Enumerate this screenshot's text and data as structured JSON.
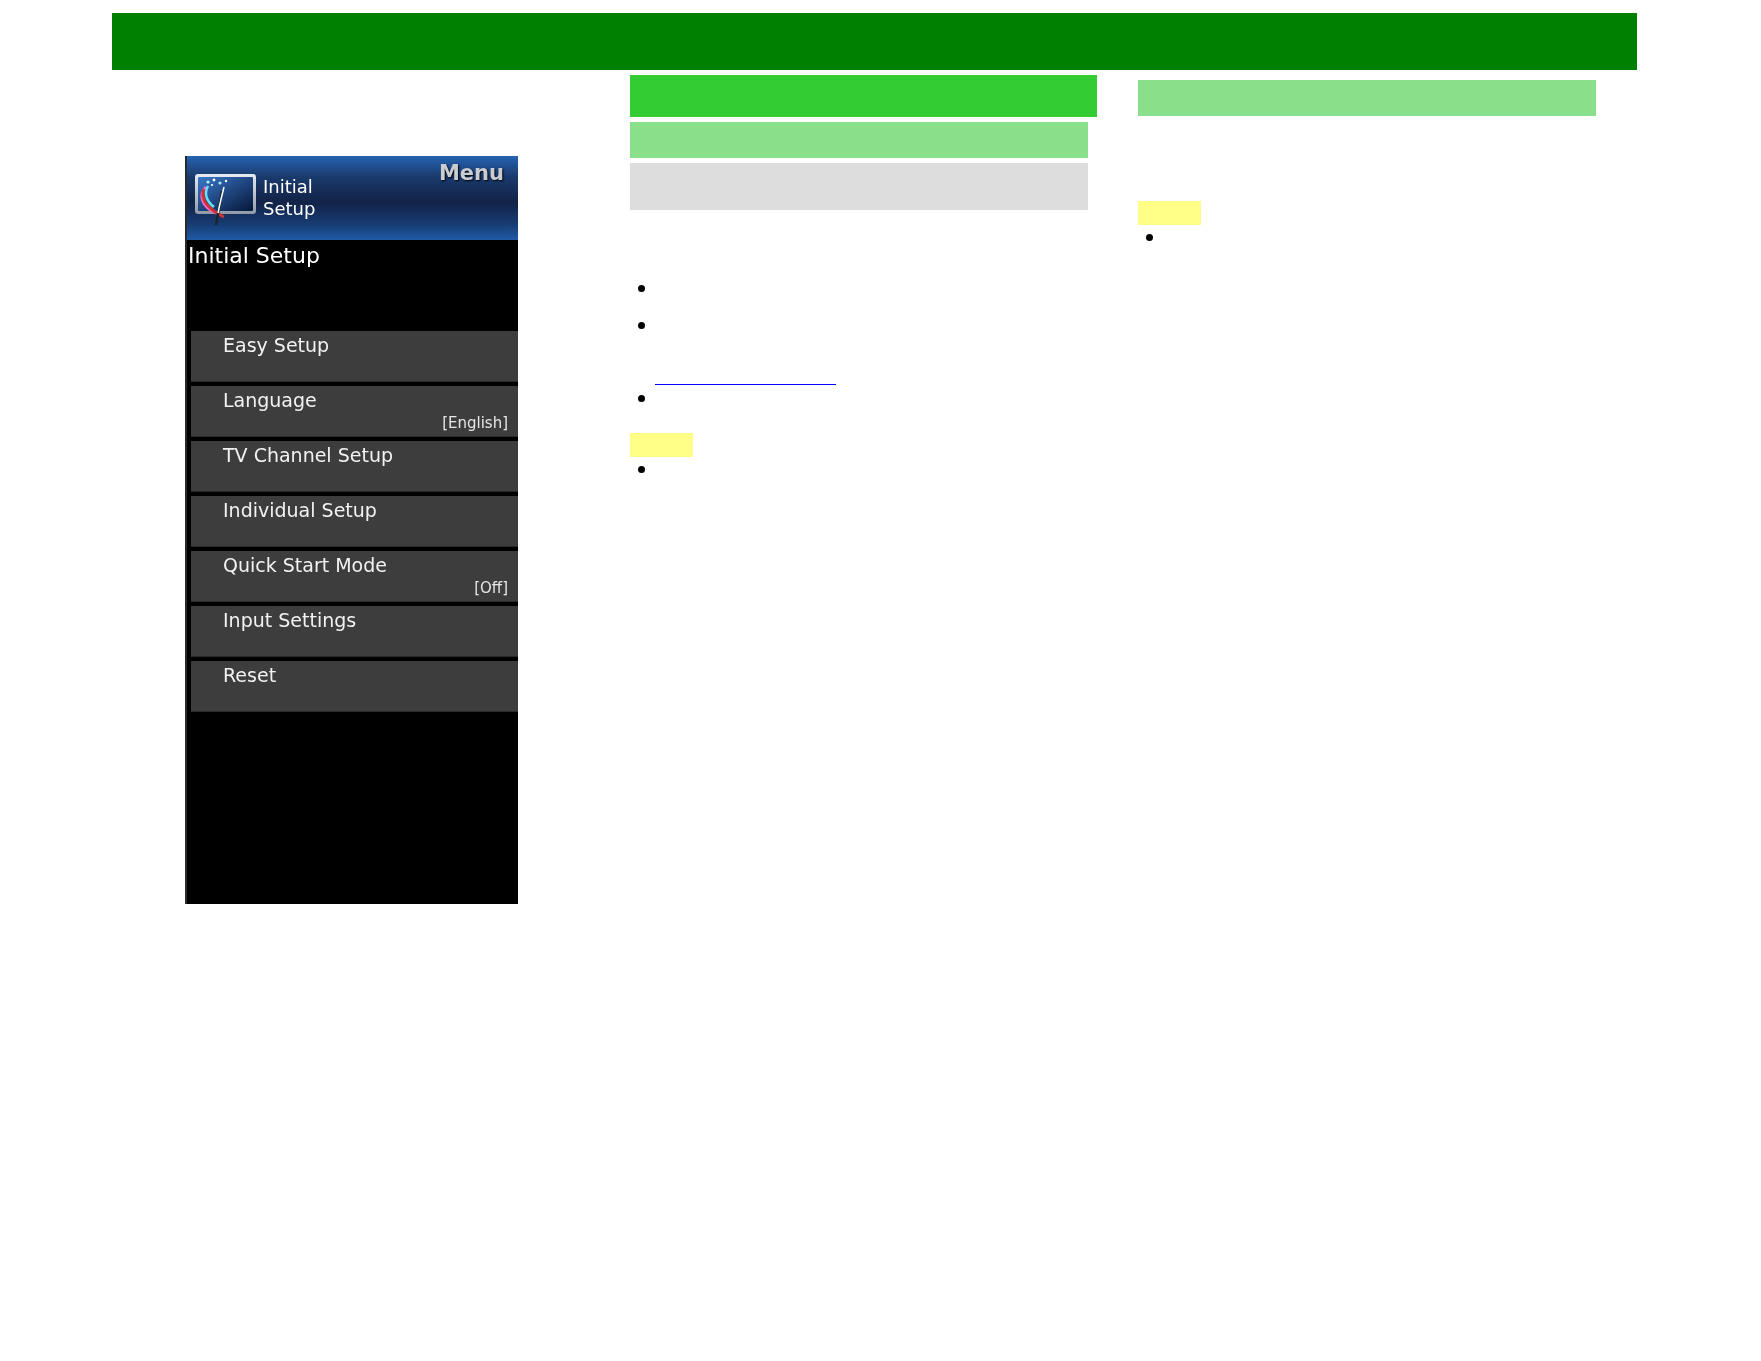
{
  "tv_menu": {
    "category": "Initial Setup",
    "menu_label": "Menu",
    "title": "Initial Setup",
    "items": [
      {
        "label": "Easy Setup"
      },
      {
        "label": "Language",
        "value": "[English]"
      },
      {
        "label": "TV Channel Setup"
      },
      {
        "label": "Individual Setup"
      },
      {
        "label": "Quick Start Mode",
        "value": "[Off]"
      },
      {
        "label": "Input Settings"
      },
      {
        "label": "Reset"
      }
    ]
  },
  "columns": [
    {
      "blocks": [
        {
          "kind": "title_bar"
        },
        {
          "kind": "section_bar"
        },
        {
          "kind": "subsection_bar"
        },
        {
          "kind": "bullet"
        },
        {
          "kind": "bullet_link"
        },
        {
          "kind": "bullet"
        },
        {
          "kind": "note_tag"
        },
        {
          "kind": "bullet"
        }
      ]
    },
    {
      "blocks": [
        {
          "kind": "section_bar"
        },
        {
          "kind": "note_tag"
        },
        {
          "kind": "bullet"
        }
      ]
    }
  ]
}
